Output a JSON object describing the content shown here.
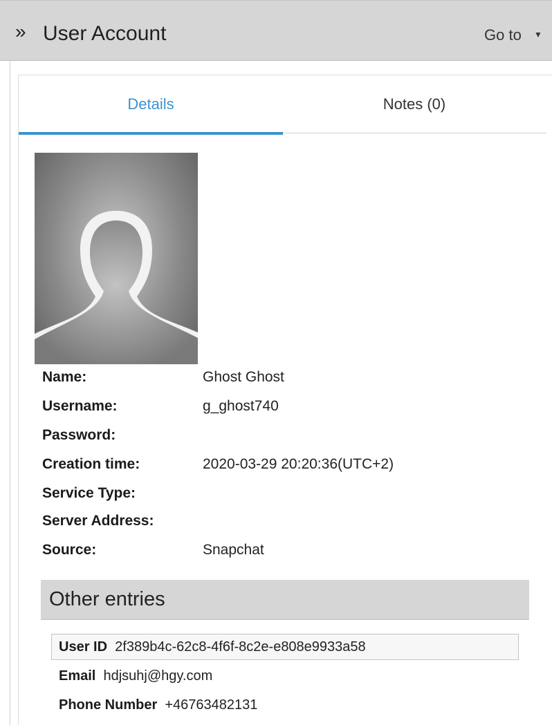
{
  "header": {
    "chevron": "»",
    "title": "User Account",
    "goto_label": "Go to",
    "caret": "▼"
  },
  "tabs": [
    {
      "label": "Details",
      "active": true
    },
    {
      "label": "Notes (0)",
      "active": false
    }
  ],
  "colors": {
    "accent": "#3c93d0",
    "header_bg": "#d6d6d6"
  },
  "avatar": {
    "icon": "person-placeholder-icon"
  },
  "fields": [
    {
      "label": "Name:",
      "value": "Ghost Ghost"
    },
    {
      "label": "Username:",
      "value": "g_ghost740"
    },
    {
      "label": "Password:",
      "value": ""
    },
    {
      "label": "Creation time:",
      "value": "2020-03-29 20:20:36(UTC+2)"
    },
    {
      "label": "Service Type:",
      "value": ""
    },
    {
      "label": "Server Address:",
      "value": ""
    },
    {
      "label": "Source:",
      "value": "Snapchat"
    }
  ],
  "other_entries": {
    "title": "Other entries",
    "items": [
      {
        "label": "User ID",
        "value": "2f389b4c-62c8-4f6f-8c2e-e808e9933a58"
      },
      {
        "label": "Email",
        "value": "hdjsuhj@hgy.com"
      },
      {
        "label": "Phone Number",
        "value": "+46763482131"
      }
    ]
  }
}
